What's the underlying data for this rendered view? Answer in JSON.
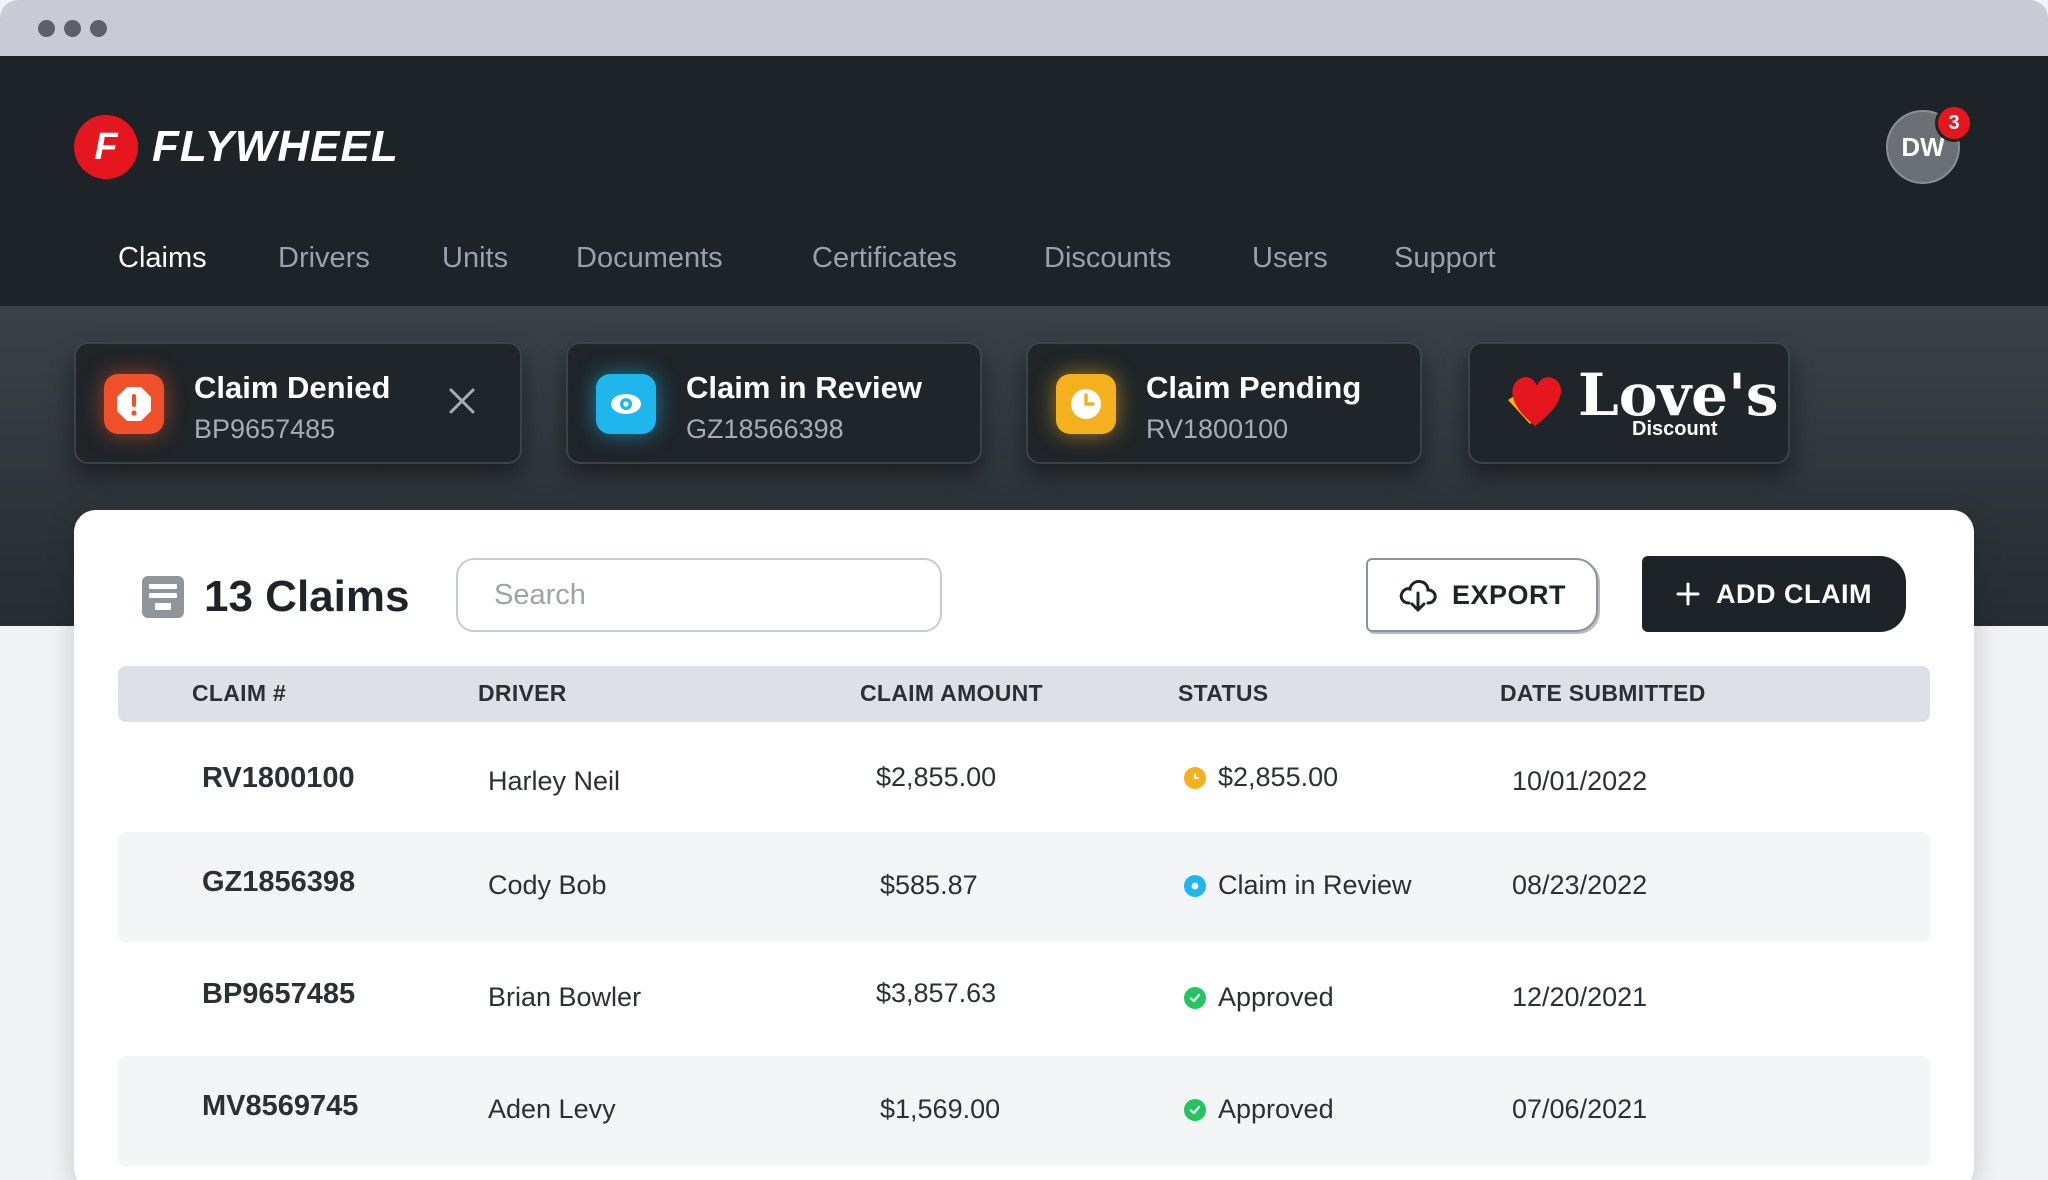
{
  "app": {
    "name": "FLYWHEEL",
    "logo_letter": "F",
    "brand_color": "#e5161d",
    "dark_color": "#1d2327"
  },
  "user": {
    "initials": "DW",
    "notifications": "3"
  },
  "nav": [
    {
      "label": "Claims",
      "active": true
    },
    {
      "label": "Drivers"
    },
    {
      "label": "Units"
    },
    {
      "label": "Documents"
    },
    {
      "label": "Certificates"
    },
    {
      "label": "Discounts"
    },
    {
      "label": "Users"
    },
    {
      "label": "Support"
    }
  ],
  "cards": [
    {
      "title": "Claim Denied",
      "id": "BP9657485",
      "icon": "alert-octagon-icon",
      "color": "#f0512a"
    },
    {
      "title": "Claim in Review",
      "id": "GZ18566398",
      "icon": "eye-icon",
      "color": "#1fb6ee"
    },
    {
      "title": "Claim Pending",
      "id": "RV1800100",
      "icon": "clock-icon",
      "color": "#f5b01e"
    }
  ],
  "promo": {
    "brand": "Love's",
    "sub": "Discount"
  },
  "claims_panel": {
    "title": "13 Claims",
    "search_placeholder": "Search",
    "export_label": "EXPORT",
    "add_label": "ADD CLAIM"
  },
  "table": {
    "headers": [
      "CLAIM #",
      "DRIVER",
      "CLAIM AMOUNT",
      "STATUS",
      "DATE SUBMITTED"
    ],
    "rows": [
      {
        "id": "RV1800100",
        "driver": "Harley Neil",
        "amount": "$2,855.00",
        "status": "$2,855.00",
        "status_type": "pending",
        "date": "10/01/2022"
      },
      {
        "id": "GZ1856398",
        "driver": "Cody Bob",
        "amount": "$585.87",
        "status": "Claim in Review",
        "status_type": "review",
        "date": "08/23/2022"
      },
      {
        "id": "BP9657485",
        "driver": "Brian Bowler",
        "amount": "$3,857.63",
        "status": "Approved",
        "status_type": "approved",
        "date": "12/20/2021"
      },
      {
        "id": "MV8569745",
        "driver": "Aden Levy",
        "amount": "$1,569.00",
        "status": "Approved",
        "status_type": "approved",
        "date": "07/06/2021"
      }
    ]
  }
}
